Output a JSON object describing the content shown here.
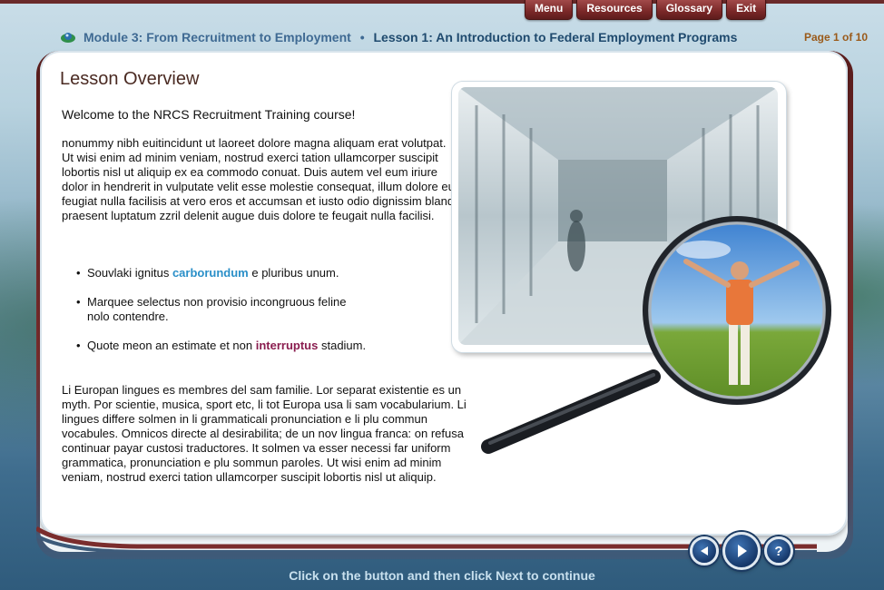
{
  "nav": {
    "menu": "Menu",
    "resources": "Resources",
    "glossary": "Glossary",
    "exit": "Exit"
  },
  "header": {
    "module": "Module 3: From Recruitment to Employment",
    "separator": "•",
    "lesson": "Lesson 1: An Introduction to Federal Employment Programs",
    "page_counter": "Page 1 of 10"
  },
  "content": {
    "title": "Lesson Overview",
    "welcome": "Welcome to the NRCS Recruitment Training course!",
    "paragraph1": "nonummy nibh euitincidunt ut laoreet dolore magna aliquam erat volutpat. Ut wisi enim ad minim veniam, nostrud exerci tation ullamcorper suscipit lobortis nisl ut aliquip ex ea commodo conuat. Duis autem vel eum iriure dolor in hendrerit in vulputate velit esse molestie consequat, illum dolore eu feugiat nulla facilisis at vero eros et accumsan et iusto odio dignissim blandit praesent luptatum zzril delenit augue duis dolore te feugait nulla facilisi.",
    "bullets": [
      {
        "before": "Souvlaki ignitus ",
        "link": "carborundum",
        "after": " e pluribus unum."
      },
      {
        "text_line1": "Marquee selectus non provisio incongruous feline",
        "text_line2": "nolo contendre."
      },
      {
        "before": "Quote meon an estimate et non ",
        "link": "interruptus",
        "after": " stadium."
      }
    ],
    "paragraph2": "Li Europan lingues es membres del sam familie. Lor separat existentie es un myth. Por scientie, musica, sport etc, li tot Europa usa li sam vocabularium. Li lingues differe solmen in li grammaticali pronunciation e li plu commun vocabules. Omnicos directe al desirabilita; de un nov lingua franca: on refusa continuar payar custosi traductores. It solmen va esser necessi far uniform grammatica, pronunciation e plu sommun paroles. Ut wisi enim ad minim veniam, nostrud exerci tation ullamcorper suscipit lobortis nisl ut aliquip."
  },
  "controls": {
    "back_icon": "back-arrow-icon",
    "next_icon": "next-arrow-icon",
    "help_label": "?"
  },
  "footer": {
    "instruction": "Click on the button and then click Next to continue"
  },
  "colors": {
    "nav_button": "#7a2828",
    "breadcrumb": "#3f6a93",
    "page_counter": "#9a5a1a",
    "link_blue": "#2a8fc8",
    "link_purple": "#8a1d4f"
  }
}
